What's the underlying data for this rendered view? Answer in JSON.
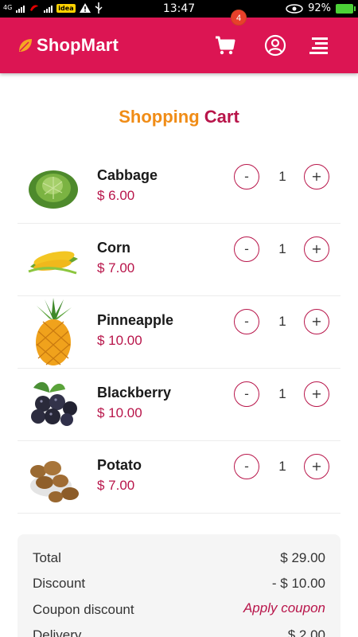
{
  "status_bar": {
    "network_label": "4G",
    "carrier_label": "idea",
    "time": "13:47",
    "battery": "92%"
  },
  "header": {
    "brand": "ShopMart",
    "cart_count": "4",
    "brand_color": "#dc1553"
  },
  "title": {
    "part1": "Shopping",
    "part2": "Cart"
  },
  "items": [
    {
      "name": "Cabbage",
      "price": "$ 6.00",
      "qty": "1",
      "minus": "-",
      "plus": "+"
    },
    {
      "name": "Corn",
      "price": "$ 7.00",
      "qty": "1",
      "minus": "-",
      "plus": "+"
    },
    {
      "name": "Pinneapple",
      "price": "$ 10.00",
      "qty": "1",
      "minus": "-",
      "plus": "+"
    },
    {
      "name": "Blackberry",
      "price": "$ 10.00",
      "qty": "1",
      "minus": "-",
      "plus": "+"
    },
    {
      "name": "Potato",
      "price": "$ 7.00",
      "qty": "1",
      "minus": "-",
      "plus": "+"
    }
  ],
  "summary": {
    "total_label": "Total",
    "total_value": "$ 29.00",
    "discount_label": "Discount",
    "discount_value": "- $ 10.00",
    "coupon_label": "Coupon discount",
    "coupon_link": "Apply coupon",
    "delivery_label": "Delivery",
    "delivery_value": "$ 2.00"
  }
}
